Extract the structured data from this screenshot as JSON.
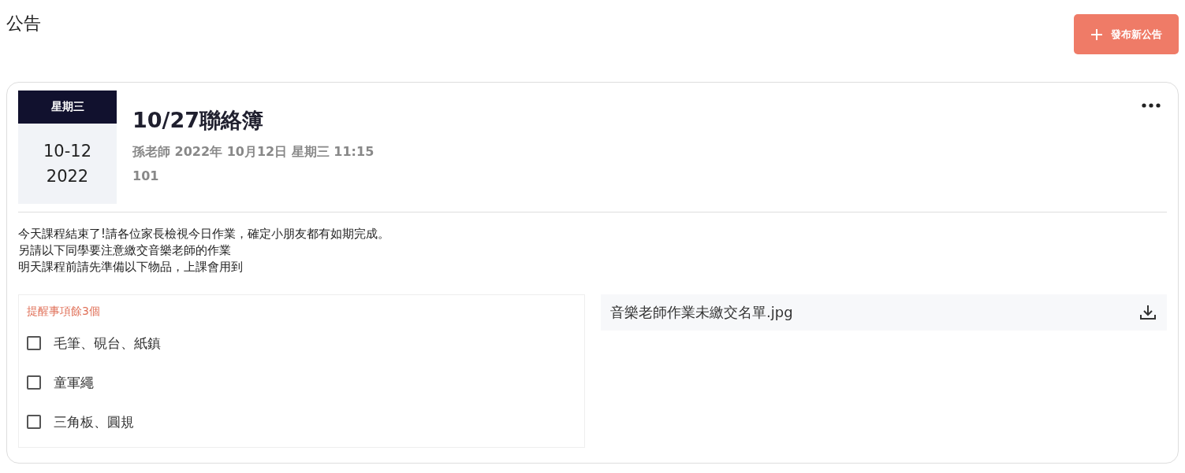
{
  "page_title": "公告",
  "new_button": {
    "label": "發布新公告"
  },
  "announcement": {
    "weekday": "星期三",
    "date": "10-12",
    "year": "2022",
    "title": "10/27聯絡簿",
    "meta": "孫老師 2022年 10月12日 星期三 11:15",
    "class_name": "101",
    "body": [
      "今天課程結束了!請各位家長檢視今日作業，確定小朋友都有如期完成。",
      "另請以下同學要注意繳交音樂老師的作業",
      "明天課程前請先準備以下物品，上課會用到"
    ],
    "reminder_title": "提醒事項餘3個",
    "reminders": [
      {
        "label": "毛筆、硯台、紙鎮",
        "checked": false
      },
      {
        "label": "童軍繩",
        "checked": false
      },
      {
        "label": "三角板、圓規",
        "checked": false
      }
    ],
    "attachments": [
      {
        "name": "音樂老師作業未繳交名單.jpg"
      }
    ]
  }
}
